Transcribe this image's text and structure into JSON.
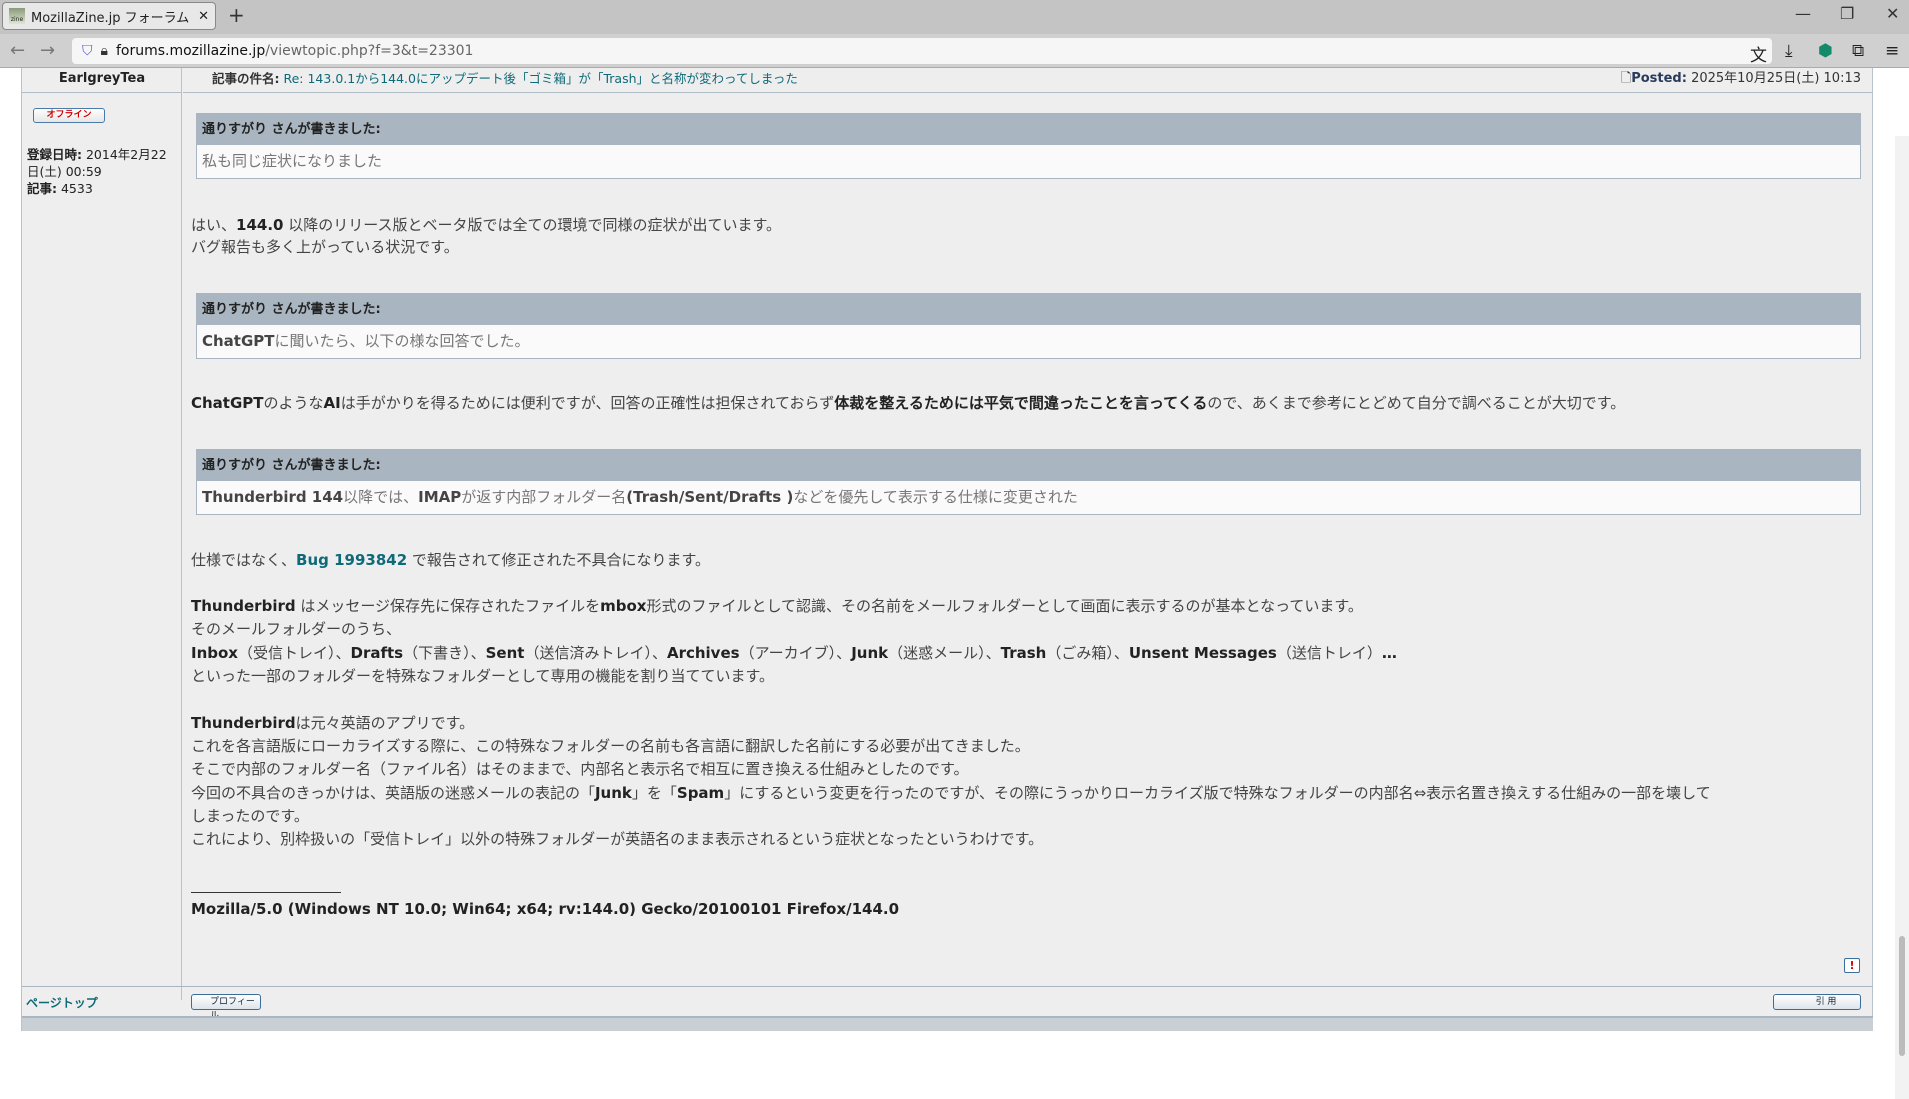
{
  "browser": {
    "tab_title": "MozillaZine.jp フォーラム • トピ",
    "url_domain": "forums.mozillazine.jp",
    "url_path": "/viewtopic.php?f=3&t=23301"
  },
  "post": {
    "author": "EarlgreyTea",
    "status": "オフライン",
    "reg_label": "登録日時:",
    "reg_value": "2014年2月22日(土) 00:59",
    "posts_label": "記事:",
    "posts_value": "4533",
    "subject_label": "記事の件名:",
    "subject": "Re: 143.0.1から144.0にアップデート後「ゴミ箱」が「Trash」と名称が変わってしまった",
    "posted_label": "Posted:",
    "posted_value": "2025年10月25日(土) 10:13",
    "quotes": [
      {
        "header": "通りすがり さんが書きました:",
        "segments": [
          {
            "t": "私も同じ症状になりました"
          }
        ]
      },
      {
        "header": "通りすがり さんが書きました:",
        "segments": [
          {
            "t": "ChatGPT",
            "b": true
          },
          {
            "t": "に聞いたら、以下の様な回答でした。"
          }
        ]
      },
      {
        "header": "通りすがり さんが書きました:",
        "segments": [
          {
            "t": "Thunderbird 144",
            "b": true
          },
          {
            "t": "以降では、"
          },
          {
            "t": "IMAP",
            "b": true
          },
          {
            "t": "が返す内部フォルダー名"
          },
          {
            "t": "(Trash/Sent/Drafts )",
            "b": true
          },
          {
            "t": "などを優先して表示する仕様に変更された"
          }
        ]
      }
    ],
    "lines": [
      [
        {
          "t": "はい、"
        },
        {
          "t": "144.0",
          "b": true
        },
        {
          "t": " 以降のリリース版とベータ版では全ての環境で同様の症状が出ています。"
        }
      ],
      [
        {
          "t": "バグ報告も多く上がっている状況です。"
        }
      ],
      [
        {
          "t": "ChatGPT",
          "b": true
        },
        {
          "t": "のような"
        },
        {
          "t": "AI",
          "b": true
        },
        {
          "t": "は手がかりを得るためには便利ですが、回答の正確性は担保されておらず"
        },
        {
          "t": "体裁を整えるためには平気で間違ったことを言ってくる",
          "b": true
        },
        {
          "t": "ので、あくまで参考にとどめて自分で調べることが大切です。"
        }
      ],
      [
        {
          "t": "仕様ではなく、"
        },
        {
          "t": "Bug 1993842",
          "link": true
        },
        {
          "t": " で報告されて修正された不具合になります。"
        }
      ],
      [
        {
          "t": "Thunderbird",
          "b": true
        },
        {
          "t": " はメッセージ保存先に保存されたファイルを"
        },
        {
          "t": "mbox",
          "b": true
        },
        {
          "t": "形式のファイルとして認識、その名前をメールフォルダーとして画面に表示するのが基本となっています。"
        }
      ],
      [
        {
          "t": "そのメールフォルダーのうち、"
        }
      ],
      [
        {
          "t": "Inbox",
          "b": true
        },
        {
          "t": "（受信トレイ）、"
        },
        {
          "t": "Drafts",
          "b": true
        },
        {
          "t": "（下書き）、"
        },
        {
          "t": "Sent",
          "b": true
        },
        {
          "t": "（送信済みトレイ）、"
        },
        {
          "t": "Archives",
          "b": true
        },
        {
          "t": "（アーカイブ）、"
        },
        {
          "t": "Junk",
          "b": true
        },
        {
          "t": "（迷惑メール）、"
        },
        {
          "t": "Trash",
          "b": true
        },
        {
          "t": "（ごみ箱）、"
        },
        {
          "t": "Unsent Messages",
          "b": true
        },
        {
          "t": "（送信トレイ）"
        },
        {
          "t": "…",
          "b": true
        }
      ],
      [
        {
          "t": "といった一部のフォルダーを特殊なフォルダーとして専用の機能を割り当てています。"
        }
      ],
      [
        {
          "t": "Thunderbird",
          "b": true
        },
        {
          "t": "は元々英語のアプリです。"
        }
      ],
      [
        {
          "t": "これを各言語版にローカライズする際に、この特殊なフォルダーの名前も各言語に翻訳した名前にする必要が出てきました。"
        }
      ],
      [
        {
          "t": "そこで内部のフォルダー名（ファイル名）はそのままで、内部名と表示名で相互に置き換える仕組みとしたのです。"
        }
      ],
      [
        {
          "t": "今回の不具合のきっかけは、英語版の迷惑メールの表記の「"
        },
        {
          "t": "Junk",
          "b": true
        },
        {
          "t": "」を「"
        },
        {
          "t": "Spam",
          "b": true
        },
        {
          "t": "」にするという変更を行ったのですが、その際にうっかりローカライズ版で特殊なフォルダーの内部名⇔表示名置き換えする仕組みの一部を壊して"
        }
      ],
      [
        {
          "t": "しまったのです。"
        }
      ],
      [
        {
          "t": "これにより、別枠扱いの「受信トレイ」以外の特殊フォルダーが英語名のまま表示されるという症状となったというわけです。"
        }
      ],
      [
        {
          "t": "Mozilla/5.0 (Windows NT 10.0; Win64; x64; rv:144.0) Gecko/20100101 Firefox/144.0",
          "b": true
        }
      ]
    ],
    "page_top": "ページトップ",
    "profile_label": "プロフィール",
    "quote_label": "引 用"
  }
}
